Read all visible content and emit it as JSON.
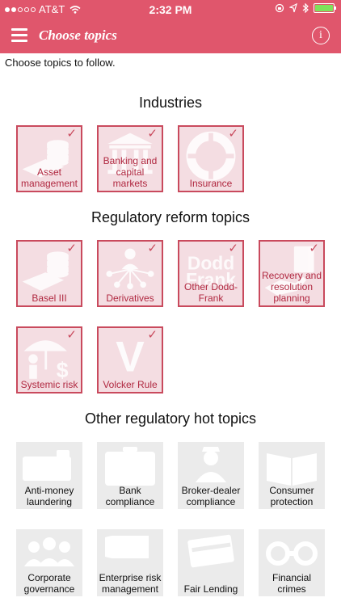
{
  "status": {
    "carrier": "AT&T",
    "time": "2:32 PM"
  },
  "header": {
    "title": "Choose topics",
    "info_glyph": "i"
  },
  "intro": "Choose topics to follow.",
  "accent_color": "#e0566c",
  "sections": [
    {
      "title": "Industries",
      "tiles": [
        {
          "label": "Asset management",
          "selected": true,
          "icon": "coins-icon"
        },
        {
          "label": "Banking and capital markets",
          "selected": true,
          "icon": "bank-building-icon"
        },
        {
          "label": "Insurance",
          "selected": true,
          "icon": "lifebuoy-icon"
        }
      ]
    },
    {
      "title": "Regulatory reform topics",
      "tiles": [
        {
          "label": "Basel III",
          "selected": true,
          "icon": "coins-icon"
        },
        {
          "label": "Derivatives",
          "selected": true,
          "icon": "network-person-icon"
        },
        {
          "label": "Other Dodd-Frank",
          "selected": true,
          "icon": "dodd-frank-text-icon",
          "art_text": [
            "Dodd",
            "Frank"
          ]
        },
        {
          "label": "Recovery and resolution planning",
          "selected": true,
          "icon": "hand-card-icon"
        },
        {
          "label": "Systemic risk",
          "selected": true,
          "icon": "umbrella-dollar-icon"
        },
        {
          "label": "Volcker Rule",
          "selected": true,
          "icon": "letter-v-icon",
          "art_text": [
            "V"
          ]
        }
      ]
    },
    {
      "title": "Other regulatory hot topics",
      "tiles": [
        {
          "label": "Anti-money laundering",
          "selected": false,
          "icon": "wallet-icon"
        },
        {
          "label": "Bank compliance",
          "selected": false,
          "icon": "briefcase-icon"
        },
        {
          "label": "Broker-dealer compliance",
          "selected": false,
          "icon": "businessman-icon"
        },
        {
          "label": "Consumer protection",
          "selected": false,
          "icon": "open-book-icon"
        },
        {
          "label": "Corporate governance",
          "selected": false,
          "icon": "people-group-icon"
        },
        {
          "label": "Enterprise risk management",
          "selected": false,
          "icon": "building-icon"
        },
        {
          "label": "Fair Lending",
          "selected": false,
          "icon": "credit-card-icon"
        },
        {
          "label": "Financial crimes",
          "selected": false,
          "icon": "handcuffs-icon"
        }
      ]
    }
  ]
}
